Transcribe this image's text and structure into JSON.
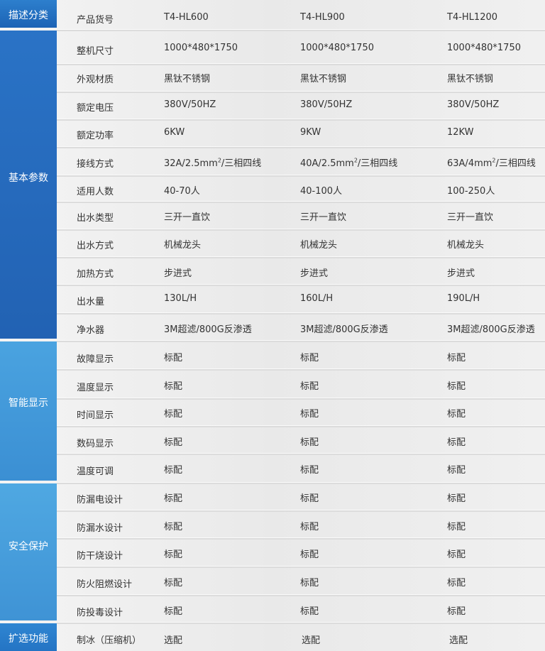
{
  "categories": [
    {
      "label": "描述分类"
    },
    {
      "label": "基本参数"
    },
    {
      "label": "智能显示"
    },
    {
      "label": "安全保护"
    },
    {
      "label": "扩选功能"
    }
  ],
  "rows": [
    {
      "label": "产品货号",
      "values": [
        "T4-HL600",
        "T4-HL900",
        "T4-HL1200"
      ]
    },
    {
      "label": "整机尺寸",
      "values": [
        "1000*480*1750",
        "1000*480*1750",
        "1000*480*1750"
      ]
    },
    {
      "label": "外观材质",
      "values": [
        "黑钛不锈钢",
        "黑钛不锈钢",
        "黑钛不锈钢"
      ]
    },
    {
      "label": "额定电压",
      "values": [
        "380V/50HZ",
        "380V/50HZ",
        "380V/50HZ"
      ]
    },
    {
      "label": "额定功率",
      "values": [
        "6KW",
        "9KW",
        "12KW"
      ]
    },
    {
      "label": "接线方式",
      "values": [
        {
          "pre": "32A/2.5mm",
          "sup": "2",
          "post": "/三相四线"
        },
        {
          "pre": "40A/2.5mm",
          "sup": "2",
          "post": "/三相四线"
        },
        {
          "pre": "63A/4mm",
          "sup": "2",
          "post": "/三相四线"
        }
      ]
    },
    {
      "label": "适用人数",
      "values": [
        "40-70人",
        "40-100人",
        "100-250人"
      ]
    },
    {
      "label": "出水类型",
      "values": [
        "三开一直饮",
        "三开一直饮",
        "三开一直饮"
      ]
    },
    {
      "label": "出水方式",
      "values": [
        "机械龙头",
        "机械龙头",
        "机械龙头"
      ]
    },
    {
      "label": "加热方式",
      "values": [
        "步进式",
        "步进式",
        "步进式"
      ]
    },
    {
      "label": "出水量",
      "values": [
        "130L/H",
        "160L/H",
        "190L/H"
      ]
    },
    {
      "label": "净水器",
      "values": [
        "3M超滤/800G反渗透",
        "3M超滤/800G反渗透",
        "3M超滤/800G反渗透"
      ]
    },
    {
      "label": "故障显示",
      "values": [
        "标配",
        "标配",
        "标配"
      ]
    },
    {
      "label": "温度显示",
      "values": [
        "标配",
        "标配",
        "标配"
      ]
    },
    {
      "label": "时间显示",
      "values": [
        "标配",
        "标配",
        "标配"
      ]
    },
    {
      "label": "数码显示",
      "values": [
        "标配",
        "标配",
        "标配"
      ]
    },
    {
      "label": "温度可调",
      "values": [
        "标配",
        "标配",
        "标配"
      ]
    },
    {
      "label": "防漏电设计",
      "values": [
        "标配",
        "标配",
        "标配"
      ]
    },
    {
      "label": "防漏水设计",
      "values": [
        "标配",
        "标配",
        "标配"
      ]
    },
    {
      "label": "防干烧设计",
      "values": [
        "标配",
        "标配",
        "标配"
      ]
    },
    {
      "label": "防火阻燃设计",
      "values": [
        "标配",
        "标配",
        "标配"
      ]
    },
    {
      "label": "防投毒设计",
      "values": [
        "标配",
        "标配",
        "标配"
      ]
    },
    {
      "label": "制冰（压缩机）",
      "values": [
        "选配",
        "选配",
        "选配"
      ]
    }
  ]
}
